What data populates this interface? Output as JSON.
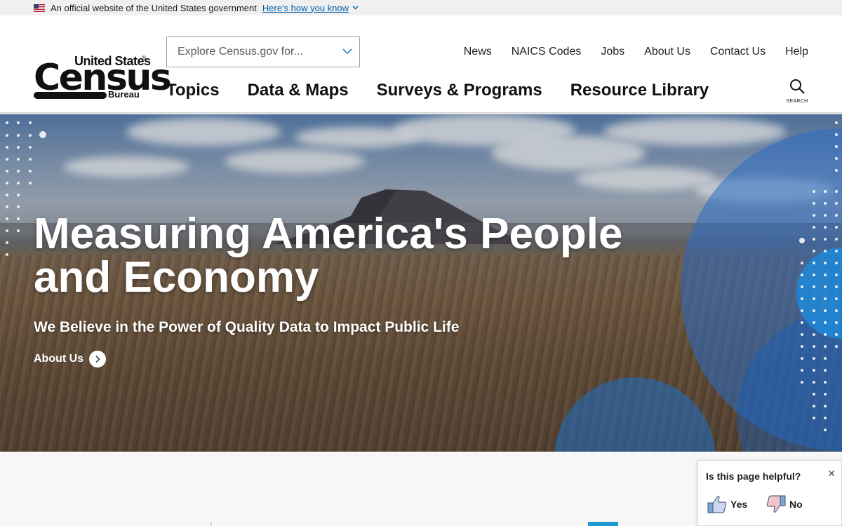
{
  "gov_banner": {
    "text": "An official website of the United States government",
    "link": "Here's how you know"
  },
  "logo": {
    "line1": "United States",
    "line2": "Census",
    "line3": "Bureau"
  },
  "search": {
    "placeholder": "Explore Census.gov for..."
  },
  "utility_nav": [
    "News",
    "NAICS Codes",
    "Jobs",
    "About Us",
    "Contact Us",
    "Help"
  ],
  "main_nav": [
    "Topics",
    "Data & Maps",
    "Surveys & Programs",
    "Resource Library"
  ],
  "search_button": {
    "label": "SEARCH",
    "icon": "search-icon"
  },
  "hero": {
    "title": "Measuring America's People and Economy",
    "subtitle": "We Believe in the Power of Quality Data to Impact Public Life",
    "link": "About Us"
  },
  "feedback": {
    "title": "Is this page helpful?",
    "close": "✕",
    "yes": "Yes",
    "no": "No"
  },
  "colors": {
    "link": "#005ea2",
    "accent_blue": "#1d9bd1"
  }
}
